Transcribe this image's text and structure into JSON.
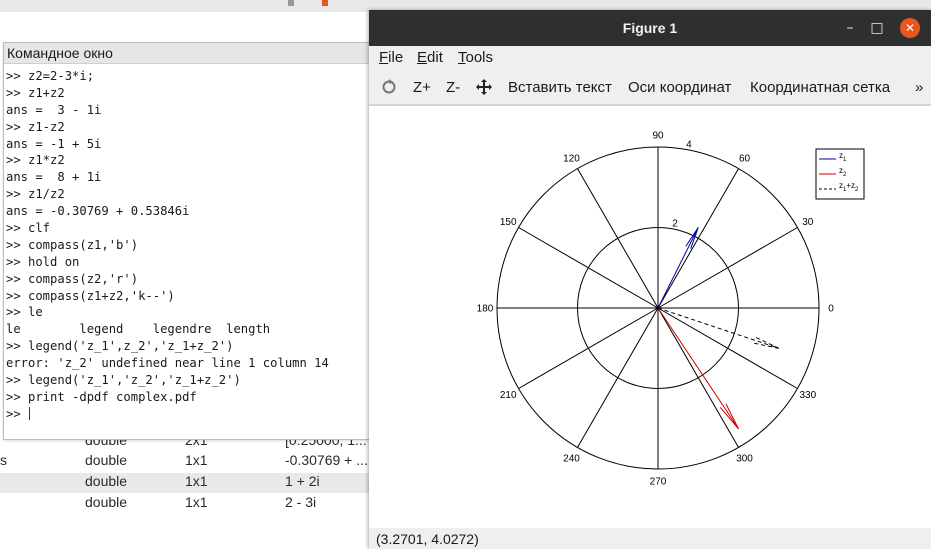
{
  "workspace": {
    "rows": [
      {
        "type": "double",
        "size": "2x1",
        "value": "[0.25000; 1...",
        "name": ""
      },
      {
        "type": "double",
        "size": "1x1",
        "value": "-0.30769 + ...",
        "name": "s"
      },
      {
        "type": "double",
        "size": "1x1",
        "value": "1 + 2i",
        "name": ""
      },
      {
        "type": "double",
        "size": "1x1",
        "value": "2 - 3i",
        "name": ""
      }
    ]
  },
  "command_window": {
    "title": "Командное окно",
    "lines": [
      ">> z2=2-3*i;",
      ">> z1+z2",
      "ans =  3 - 1i",
      ">> z1-z2",
      "ans = -1 + 5i",
      ">> z1*z2",
      "ans =  8 + 1i",
      ">> z1/z2",
      "ans = -0.30769 + 0.53846i",
      ">> clf",
      ">> compass(z1,'b')",
      ">> hold on",
      ">> compass(z2,'r')",
      ">> compass(z1+z2,'k--')",
      ">> le",
      "le        legend    legendre  length",
      ">> legend('z_1',z_2','z_1+z_2')",
      "error: 'z_2' undefined near line 1 column 14",
      ">> legend('z_1','z_2','z_1+z_2')",
      ">> print -dpdf complex.pdf",
      ">> "
    ]
  },
  "figure": {
    "title": "Figure 1",
    "menu": {
      "file": "ile",
      "file_u": "F",
      "edit": "dit",
      "edit_u": "E",
      "tools": "ools",
      "tools_u": "T"
    },
    "toolbar": {
      "zoom_in": "Z+",
      "zoom_out": "Z-",
      "insert_text": "Вставить текст",
      "axes": "Оси координат",
      "grid": "Координатная сетка",
      "more": "»"
    },
    "status": "(3.2701, 4.0272)",
    "window_buttons": {
      "minimize": "–",
      "maximize": "□",
      "close": "✕"
    }
  },
  "chart_data": {
    "type": "compass",
    "angle_ticks": [
      "0",
      "30",
      "60",
      "90",
      "120",
      "150",
      "180",
      "210",
      "240",
      "270",
      "300",
      "330"
    ],
    "radial_ticks": [
      "2",
      "4"
    ],
    "rmax": 4,
    "series": [
      {
        "name": "z_1",
        "x": 1,
        "y": 2,
        "color": "#0000aa",
        "style": "solid"
      },
      {
        "name": "z_2",
        "x": 2,
        "y": -3,
        "color": "#cc0000",
        "style": "solid"
      },
      {
        "name": "z_1+z_2",
        "x": 3,
        "y": -1,
        "color": "#000000",
        "style": "dashed"
      }
    ],
    "legend_labels": [
      {
        "base": "z",
        "sub": "1"
      },
      {
        "base": "z",
        "sub": "2"
      },
      {
        "base": "z",
        "sub": "1",
        "tail": "+z",
        "sub2": "2"
      }
    ],
    "legend_position": "top-right"
  }
}
